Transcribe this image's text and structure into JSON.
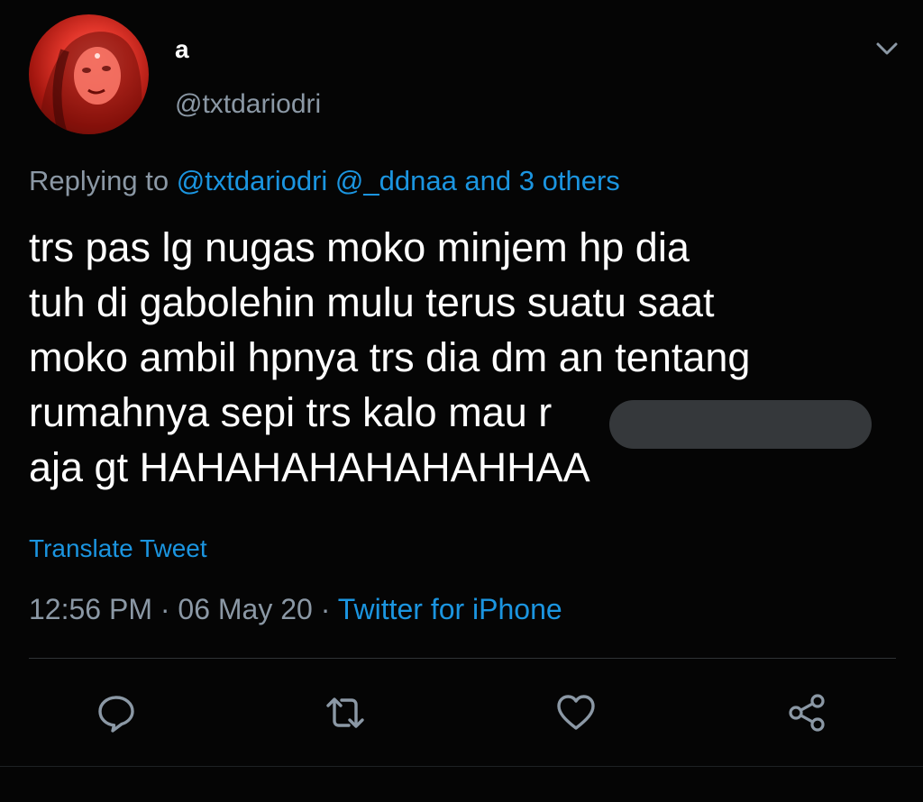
{
  "user": {
    "display_name": "a",
    "handle": "@txtdariodri",
    "avatar": "avatar-photo"
  },
  "reply": {
    "prefix": "Replying to",
    "mentions": "@txtdariodri @_ddnaa and 3 others"
  },
  "tweet": {
    "lines": [
      "trs pas lg nugas moko minjem hp dia",
      "tuh di gabolehin mulu terus suatu saat",
      "moko ambil hpnya trs dia dm an tentang",
      "rumahnya sepi trs kalo mau r",
      "aja gt HAHAHAHAHAHAHHAA"
    ]
  },
  "translate_label": "Translate Tweet",
  "meta": {
    "time": "12:56 PM",
    "sep1": " · ",
    "date": "06 May 20",
    "sep2": " · ",
    "source": "Twitter for iPhone"
  },
  "actions": [
    {
      "name": "reply",
      "icon": "comment-icon"
    },
    {
      "name": "retweet",
      "icon": "retweet-icon"
    },
    {
      "name": "like",
      "icon": "heart-icon"
    },
    {
      "name": "share",
      "icon": "share-icon"
    }
  ],
  "colors": {
    "background": "#050505",
    "text": "#ffffff",
    "muted": "#8b98a5",
    "link": "#1b95e0",
    "redaction": "#35383b",
    "divider": "#2f3336"
  }
}
